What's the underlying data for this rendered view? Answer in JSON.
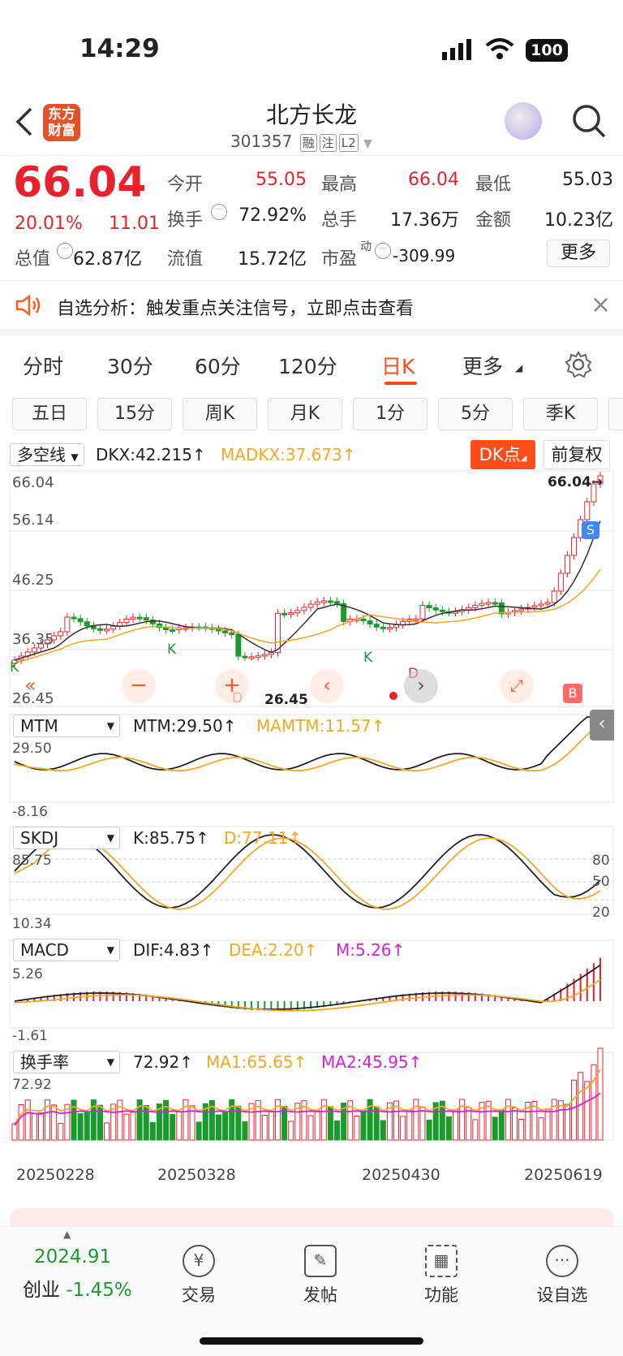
{
  "status": {
    "time": "14:29",
    "battery": "100"
  },
  "header": {
    "logo": "东方\n财富",
    "name": "北方长龙",
    "code": "301357",
    "tags": [
      "融",
      "注",
      "L2"
    ]
  },
  "quote": {
    "price": "66.04",
    "pct": "20.01%",
    "chg": "11.01",
    "fields": [
      {
        "l": "今开",
        "v": "55.05",
        "c": "#e8222d"
      },
      {
        "l": "最高",
        "v": "66.04",
        "c": "#e8222d"
      },
      {
        "l": "最低",
        "v": "55.03",
        "c": "#222"
      },
      {
        "l": "换手",
        "v": "72.92%",
        "c": "#222"
      },
      {
        "l": "总手",
        "v": "17.36万",
        "c": "#222"
      },
      {
        "l": "金额",
        "v": "10.23亿",
        "c": "#222"
      },
      {
        "l": "总值",
        "v": "62.87亿",
        "c": "#222"
      },
      {
        "l": "流值",
        "v": "15.72亿",
        "c": "#222"
      },
      {
        "l": "市盈",
        "v": "-309.99",
        "c": "#222"
      }
    ],
    "pe_sup": "动",
    "more": "更多"
  },
  "banner": {
    "text": "自选分析：触发重点关注信号，立即点击查看",
    "close": "×"
  },
  "tabs": [
    "分时",
    "30分",
    "60分",
    "120分",
    "日K",
    "更多"
  ],
  "active_tab": "日K",
  "subtabs": [
    "五日",
    "15分",
    "周K",
    "月K",
    "1分",
    "5分",
    "季K"
  ],
  "kline": {
    "indicator": "多空线",
    "dkx": "DKX:42.215↑",
    "madkx": "MADKX:37.673↑",
    "dk_btn": "DK点",
    "fq": "前复权",
    "yticks": [
      "66.04",
      "56.14",
      "46.25",
      "36.35",
      "26.45"
    ],
    "high_mark": "66.04→",
    "low_mark": "26.45",
    "signals": [
      "S",
      "B",
      "K",
      "K",
      "K",
      "D",
      "D"
    ]
  },
  "mtm": {
    "name": "MTM",
    "v1": "MTM:29.50↑",
    "v2": "MAMTM:11.57↑",
    "ymax": "29.50",
    "ymin": "-8.16"
  },
  "skdj": {
    "name": "SKDJ",
    "v1": "K:85.75↑",
    "v2": "D:77.11↑",
    "ymax": "85.75",
    "ymin": "10.34",
    "levels": [
      "80",
      "50",
      "20"
    ]
  },
  "macd": {
    "name": "MACD",
    "v1": "DIF:4.83↑",
    "v2": "DEA:2.20↑",
    "v3": "M:5.26↑",
    "ymax": "5.26",
    "ymin": "-1.61"
  },
  "turn": {
    "name": "换手率",
    "v1": "72.92↑",
    "v2": "MA1:65.65↑",
    "v3": "MA2:45.95↑",
    "ymax": "72.92"
  },
  "dates": [
    "20250228",
    "20250328",
    "20250430",
    "20250619"
  ],
  "nav": {
    "index_val": "2024.91",
    "index_name": "创业",
    "index_pct": "-1.45%",
    "items": [
      "交易",
      "发帖",
      "功能",
      "设自选"
    ]
  },
  "colors": {
    "up": "#e8222d",
    "down": "#1a9c2c",
    "accent": "#ff4d1a",
    "ma1": "#f5a623",
    "ma2": "#d61fd6"
  }
}
